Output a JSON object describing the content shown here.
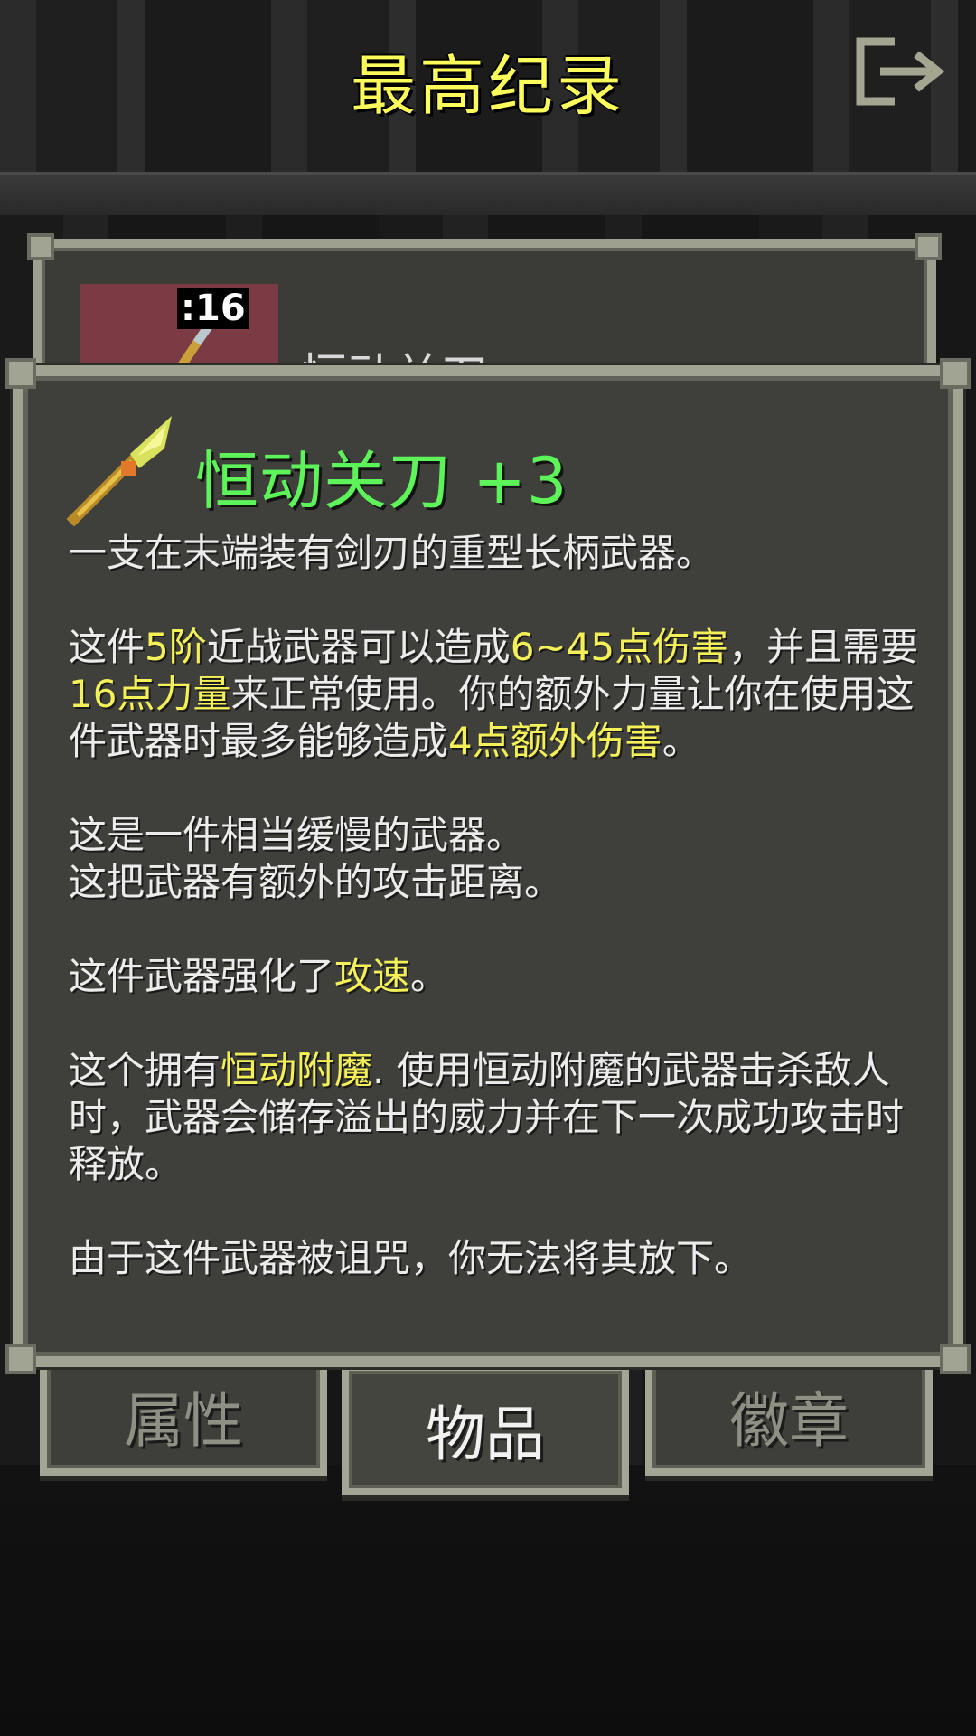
{
  "header": {
    "title": "最高纪录"
  },
  "record": {
    "quantity": ":16",
    "item_name": "恒动关刀"
  },
  "item": {
    "name": "恒动关刀 +3",
    "description_intro": "一支在末端装有剑刃的重型长柄武器。",
    "stats": {
      "p1": "这件",
      "tier": "5阶",
      "p2": "近战武器可以造成",
      "damage": "6~45点伤害",
      "p3": "，并且需要",
      "strength": "16点力量",
      "p4": "来正常使用。你的额外力量让你在使用这件武器时最多能够造成",
      "bonus": "4点额外伤害",
      "p5": "。"
    },
    "traits_line1": "这是一件相当缓慢的武器。",
    "traits_line2": "这把武器有额外的攻击距离。",
    "upgrade": {
      "p1": "这件武器强化了",
      "attr": "攻速",
      "p2": "。"
    },
    "enchant": {
      "p1": "这个拥有",
      "name": "恒动附魔",
      "p2": ". 使用恒动附魔的武器击杀敌人时，武器会储存溢出的威力并在下一次成功攻击时释放。"
    },
    "curse": "由于这件武器被诅咒，你无法将其放下。"
  },
  "tabs": [
    {
      "label": "属性"
    },
    {
      "label": "物品"
    },
    {
      "label": "徽章"
    }
  ],
  "colors": {
    "title": "#fcfc5a",
    "item_name": "#5df45a",
    "highlight": "#f4f057",
    "panel": "#3f403c",
    "border": "#a2a493"
  },
  "icons": {
    "exit": "exit-door-icon",
    "weapon": "glaive-icon"
  }
}
